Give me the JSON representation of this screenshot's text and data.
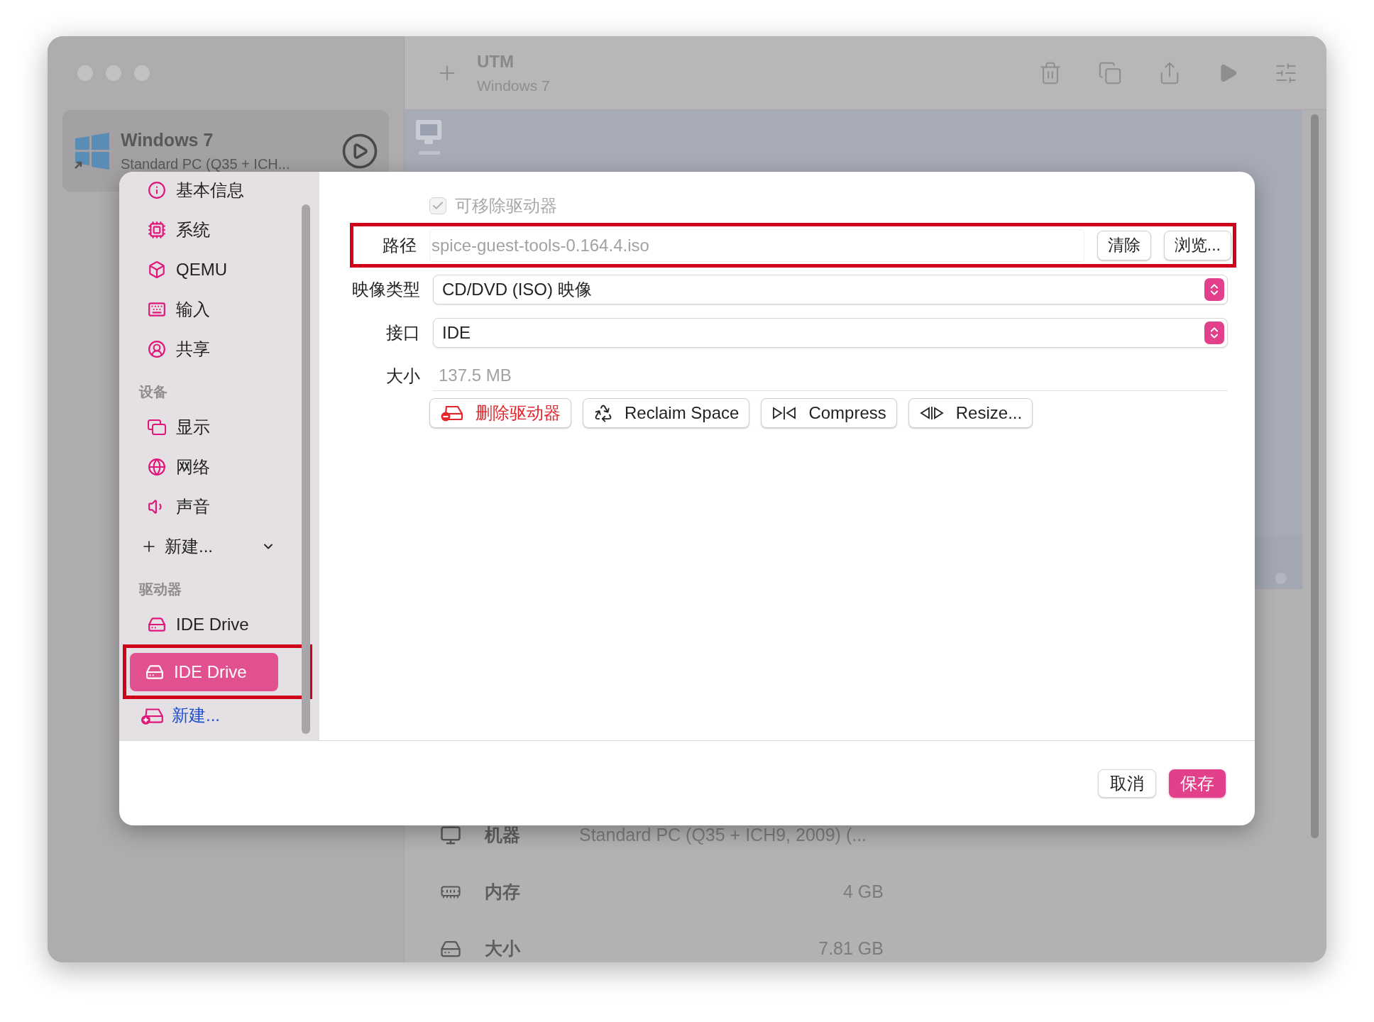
{
  "toolbar": {
    "title": "UTM",
    "subtitle": "Windows 7"
  },
  "vm_list": [
    {
      "name": "Windows 7",
      "description": "Standard PC (Q35 + ICH..."
    }
  ],
  "vm_details": [
    {
      "kind": "machine",
      "label": "机器",
      "value": "Standard PC (Q35 + ICH9, 2009) (..."
    },
    {
      "kind": "memory",
      "label": "内存",
      "value": "4 GB"
    },
    {
      "kind": "size",
      "label": "大小",
      "value": "7.81 GB"
    }
  ],
  "dialog": {
    "sidebar": [
      {
        "items": [
          {
            "kind": "item",
            "label": "基本信息",
            "selected": false,
            "highlighted": false
          },
          {
            "kind": "item",
            "label": "系统",
            "selected": false,
            "highlighted": false
          },
          {
            "kind": "item",
            "label": "QEMU",
            "selected": false,
            "highlighted": false
          },
          {
            "kind": "item",
            "label": "输入",
            "selected": false,
            "highlighted": false
          },
          {
            "kind": "item",
            "label": "共享",
            "selected": false,
            "highlighted": false
          }
        ]
      },
      {
        "title": "设备",
        "items": [
          {
            "kind": "item",
            "label": "显示",
            "selected": false,
            "highlighted": false
          },
          {
            "kind": "item",
            "label": "网络",
            "selected": false,
            "highlighted": false
          },
          {
            "kind": "item",
            "label": "声音",
            "selected": false,
            "highlighted": false
          },
          {
            "kind": "add_menu",
            "label": "新建...",
            "selected": false,
            "highlighted": false
          }
        ]
      },
      {
        "title": "驱动器",
        "items": [
          {
            "kind": "item",
            "label": "IDE Drive",
            "selected": false,
            "highlighted": false
          },
          {
            "kind": "item",
            "label": "IDE Drive",
            "selected": true,
            "highlighted": true
          },
          {
            "kind": "add_link",
            "label": "新建...",
            "selected": false,
            "highlighted": false
          }
        ]
      }
    ],
    "removable": {
      "label": "可移除驱动器",
      "checked": true,
      "disabled": true
    },
    "fields": [
      {
        "kind": "path",
        "label": "路径",
        "value": "spice-guest-tools-0.164.4.iso",
        "buttons": [
          "清除",
          "浏览..."
        ],
        "highlighted": true
      },
      {
        "kind": "select",
        "label": "映像类型",
        "value": "CD/DVD (ISO) 映像",
        "highlighted": false
      },
      {
        "kind": "select",
        "label": "接口",
        "value": "IDE",
        "highlighted": false
      },
      {
        "kind": "readonly",
        "label": "大小",
        "value": "137.5 MB",
        "highlighted": false
      }
    ],
    "actions": [
      {
        "kind": "delete",
        "label": "删除驱动器"
      },
      {
        "kind": "reclaim",
        "label": "Reclaim Space"
      },
      {
        "kind": "compress",
        "label": "Compress"
      },
      {
        "kind": "resize",
        "label": "Resize..."
      }
    ],
    "footer": [
      {
        "kind": "cancel",
        "label": "取消"
      },
      {
        "kind": "save",
        "label": "保存"
      }
    ]
  }
}
